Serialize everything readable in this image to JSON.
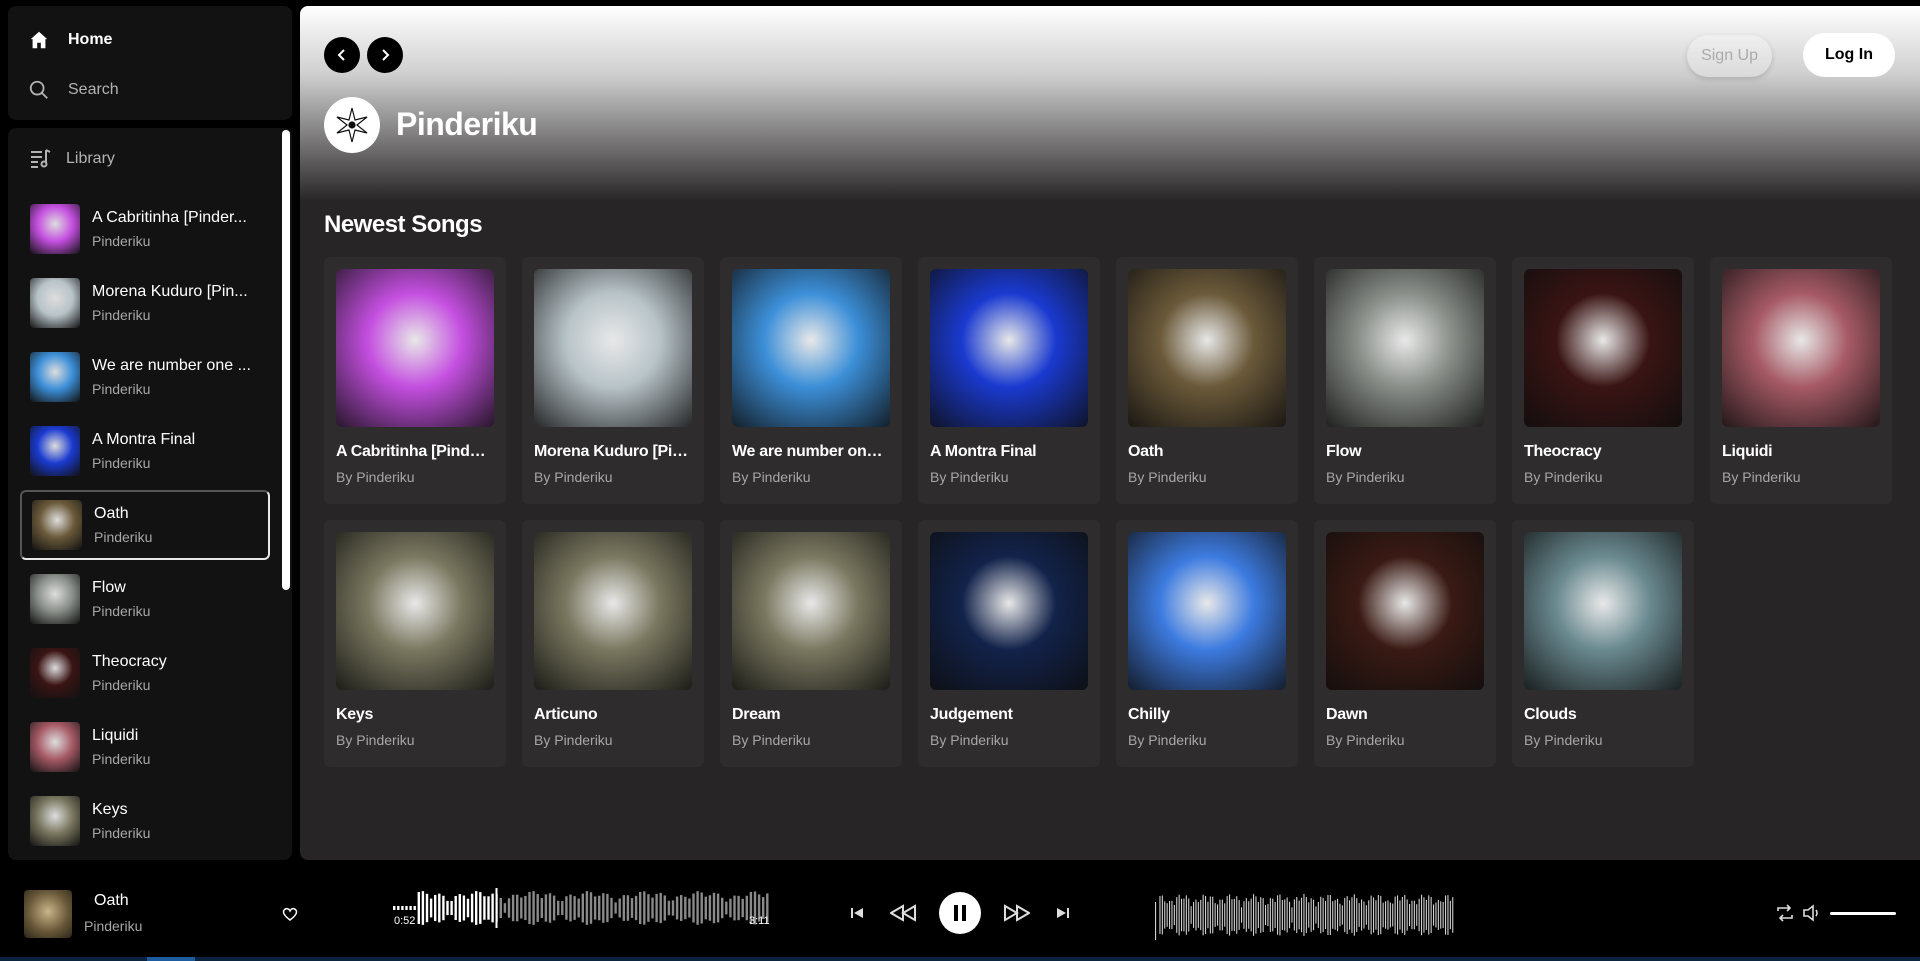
{
  "nav": {
    "home_label": "Home",
    "search_label": "Search"
  },
  "library": {
    "label": "Library",
    "items": [
      {
        "title": "A Cabritinha [Pinder...",
        "artist": "Pinderiku"
      },
      {
        "title": "Morena Kuduro [Pin...",
        "artist": "Pinderiku"
      },
      {
        "title": "We are number one ...",
        "artist": "Pinderiku"
      },
      {
        "title": "A Montra Final",
        "artist": "Pinderiku"
      },
      {
        "title": "Oath",
        "artist": "Pinderiku"
      },
      {
        "title": "Flow",
        "artist": "Pinderiku"
      },
      {
        "title": "Theocracy",
        "artist": "Pinderiku"
      },
      {
        "title": "Liquidi",
        "artist": "Pinderiku"
      },
      {
        "title": "Keys",
        "artist": "Pinderiku"
      }
    ]
  },
  "header": {
    "signup_label": "Sign Up",
    "login_label": "Log In",
    "artist_name": "Pinderiku"
  },
  "main": {
    "section_title": "Newest Songs",
    "songs": [
      {
        "title": "A Cabritinha [Pinder...",
        "by": "By Pinderiku",
        "color": "#c44fe0"
      },
      {
        "title": "Morena Kuduro [Pin...",
        "by": "By Pinderiku",
        "color": "#b8c3c8"
      },
      {
        "title": "We are number one ...",
        "by": "By Pinderiku",
        "color": "#3c8fd8"
      },
      {
        "title": "A Montra Final",
        "by": "By Pinderiku",
        "color": "#1a3ad0"
      },
      {
        "title": "Oath",
        "by": "By Pinderiku",
        "color": "#6b5a3a"
      },
      {
        "title": "Flow",
        "by": "By Pinderiku",
        "color": "#8a8f8a"
      },
      {
        "title": "Theocracy",
        "by": "By Pinderiku",
        "color": "#3a1414"
      },
      {
        "title": "Liquidi",
        "by": "By Pinderiku",
        "color": "#a65a66"
      },
      {
        "title": "Keys",
        "by": "By Pinderiku",
        "color": "#7a7860"
      },
      {
        "title": "Articuno",
        "by": "By Pinderiku",
        "color": "#7a7860"
      },
      {
        "title": "Dream",
        "by": "By Pinderiku",
        "color": "#7a7860"
      },
      {
        "title": "Judgement",
        "by": "By Pinderiku",
        "color": "#12224a"
      },
      {
        "title": "Chilly",
        "by": "By Pinderiku",
        "color": "#3d7be0"
      },
      {
        "title": "Dawn",
        "by": "By Pinderiku",
        "color": "#3a1a14"
      },
      {
        "title": "Clouds",
        "by": "By Pinderiku",
        "color": "#6a8a90"
      }
    ]
  },
  "player": {
    "title": "Oath",
    "artist": "Pinderiku",
    "elapsed": "0:52",
    "duration": "3:11",
    "progress_fraction": 0.27
  }
}
